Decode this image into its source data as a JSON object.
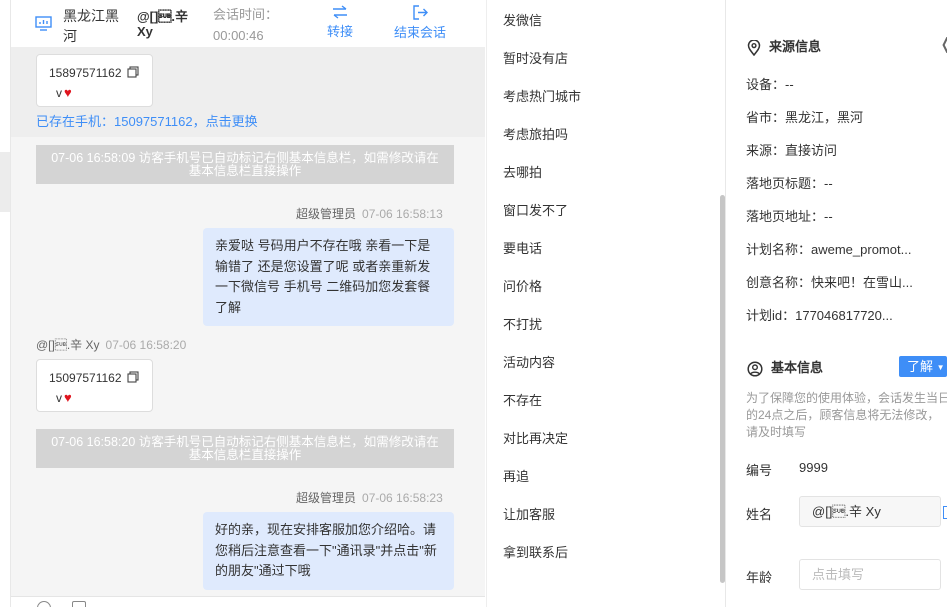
{
  "header": {
    "region": "黑龙江黑河",
    "nickname": "@[]\u001a.辛 Xy",
    "session_time_label": "会话时间：",
    "session_time_value": "00:00:46",
    "transfer_label": "转接",
    "end_label": "结束会话"
  },
  "messages": {
    "card1": {
      "number": "15897571162",
      "v": "v"
    },
    "exists_text": "已存在手机：15097571162，点击更换",
    "system1": "07-06 16:58:09 访客手机号已自动标记右侧基本信息栏，如需修改请在基本信息栏直接操作",
    "agent1": {
      "name": "超级管理员",
      "time": "07-06 16:58:13",
      "text": "亲爱哒 号码用户不存在哦 亲看一下是输错了 还是您设置了呢 或者亲重新发一下微信号 手机号 二维码加您发套餐了解"
    },
    "visitor1": {
      "name": "@[]\u001a.辛 Xy",
      "time": "07-06 16:58:20"
    },
    "card2": {
      "number": "15097571162",
      "v": "v"
    },
    "system2": "07-06 16:58:20 访客手机号已自动标记右侧基本信息栏，如需修改请在基本信息栏直接操作",
    "agent2": {
      "name": "超级管理员",
      "time": "07-06 16:58:23",
      "text": "好的亲，现在安排客服加您介绍哈。请您稍后注意查看一下\"通讯录\"并点击\"新的朋友\"通过下哦"
    }
  },
  "quick_replies": [
    "发微信",
    "暂时没有店",
    "考虑热门城市",
    "考虑旅拍吗",
    "去哪拍",
    "窗口发不了",
    "要电话",
    "问价格",
    "不打扰",
    "活动内容",
    "不存在",
    "对比再决定",
    "再追",
    "让加客服",
    "拿到联系后"
  ],
  "source_info": {
    "title": "来源信息",
    "rows": [
      "设备：--",
      "省市：黑龙江，黑河",
      "来源：直接访问",
      "落地页标题：--",
      "落地页地址：--",
      "计划名称：aweme_promot...",
      "创意名称：快来吧！在雪山...",
      "计划id：177046817720..."
    ]
  },
  "basic_info": {
    "title": "基本信息",
    "learn_label": "了解",
    "notice": "为了保障您的使用体验，会话发生当日的24点之后，顾客信息将无法修改，请及时填写",
    "id_label": "编号",
    "id_value": "9999",
    "name_label": "姓名",
    "name_value": "@[]\u001a.辛 Xy",
    "age_label": "年龄",
    "age_placeholder": "点击填写"
  },
  "colors": {
    "accent": "#3e8ef7",
    "bubble": "#dfeafd",
    "system": "#d4d4d4",
    "heart": "#e0141e"
  }
}
